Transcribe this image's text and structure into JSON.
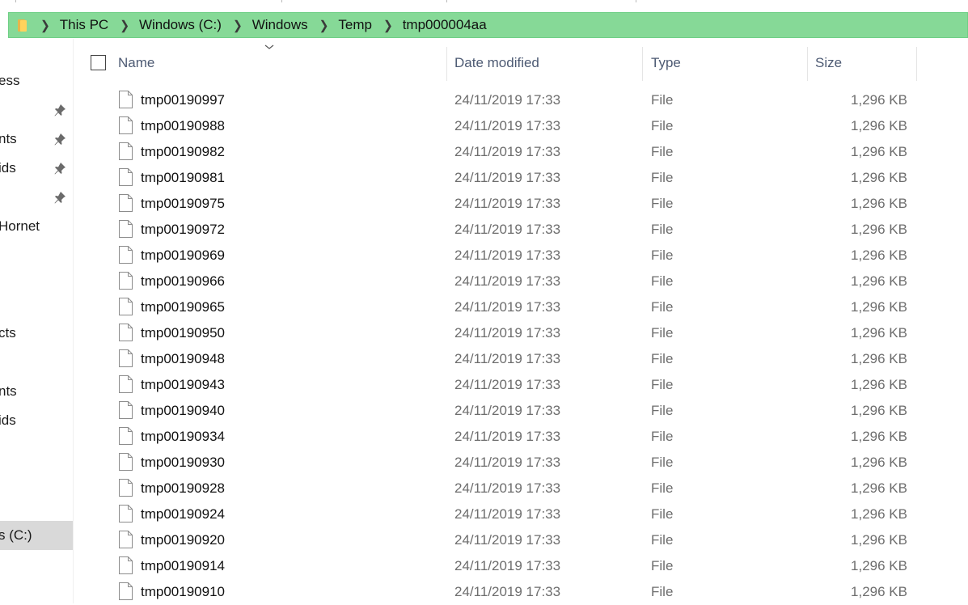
{
  "breadcrumb": [
    "This PC",
    "Windows (C:)",
    "Windows",
    "Temp",
    "tmp000004aa"
  ],
  "sidebar": {
    "items": [
      {
        "label": "ess",
        "pinned": false,
        "selected": false
      },
      {
        "label": "",
        "pinned": true,
        "selected": false
      },
      {
        "label": "nts",
        "pinned": true,
        "selected": false
      },
      {
        "label": "ids",
        "pinned": true,
        "selected": false
      },
      {
        "label": "",
        "pinned": true,
        "selected": false
      },
      {
        "label": "Hornet",
        "pinned": false,
        "selected": false
      },
      {
        "label": "cts",
        "pinned": false,
        "selected": false
      },
      {
        "label": "nts",
        "pinned": false,
        "selected": false
      },
      {
        "label": "ids",
        "pinned": false,
        "selected": false
      },
      {
        "label": "s (C:)",
        "pinned": false,
        "selected": true
      }
    ]
  },
  "columns": {
    "name": "Name",
    "date": "Date modified",
    "type": "Type",
    "size": "Size"
  },
  "files": [
    {
      "name": "tmp00190997",
      "date": "24/11/2019 17:33",
      "type": "File",
      "size": "1,296 KB"
    },
    {
      "name": "tmp00190988",
      "date": "24/11/2019 17:33",
      "type": "File",
      "size": "1,296 KB"
    },
    {
      "name": "tmp00190982",
      "date": "24/11/2019 17:33",
      "type": "File",
      "size": "1,296 KB"
    },
    {
      "name": "tmp00190981",
      "date": "24/11/2019 17:33",
      "type": "File",
      "size": "1,296 KB"
    },
    {
      "name": "tmp00190975",
      "date": "24/11/2019 17:33",
      "type": "File",
      "size": "1,296 KB"
    },
    {
      "name": "tmp00190972",
      "date": "24/11/2019 17:33",
      "type": "File",
      "size": "1,296 KB"
    },
    {
      "name": "tmp00190969",
      "date": "24/11/2019 17:33",
      "type": "File",
      "size": "1,296 KB"
    },
    {
      "name": "tmp00190966",
      "date": "24/11/2019 17:33",
      "type": "File",
      "size": "1,296 KB"
    },
    {
      "name": "tmp00190965",
      "date": "24/11/2019 17:33",
      "type": "File",
      "size": "1,296 KB"
    },
    {
      "name": "tmp00190950",
      "date": "24/11/2019 17:33",
      "type": "File",
      "size": "1,296 KB"
    },
    {
      "name": "tmp00190948",
      "date": "24/11/2019 17:33",
      "type": "File",
      "size": "1,296 KB"
    },
    {
      "name": "tmp00190943",
      "date": "24/11/2019 17:33",
      "type": "File",
      "size": "1,296 KB"
    },
    {
      "name": "tmp00190940",
      "date": "24/11/2019 17:33",
      "type": "File",
      "size": "1,296 KB"
    },
    {
      "name": "tmp00190934",
      "date": "24/11/2019 17:33",
      "type": "File",
      "size": "1,296 KB"
    },
    {
      "name": "tmp00190930",
      "date": "24/11/2019 17:33",
      "type": "File",
      "size": "1,296 KB"
    },
    {
      "name": "tmp00190928",
      "date": "24/11/2019 17:33",
      "type": "File",
      "size": "1,296 KB"
    },
    {
      "name": "tmp00190924",
      "date": "24/11/2019 17:33",
      "type": "File",
      "size": "1,296 KB"
    },
    {
      "name": "tmp00190920",
      "date": "24/11/2019 17:33",
      "type": "File",
      "size": "1,296 KB"
    },
    {
      "name": "tmp00190914",
      "date": "24/11/2019 17:33",
      "type": "File",
      "size": "1,296 KB"
    },
    {
      "name": "tmp00190910",
      "date": "24/11/2019 17:33",
      "type": "File",
      "size": "1,296 KB"
    }
  ],
  "colors": {
    "address_bar": "#86d997",
    "selected_nav": "#d9d9d9",
    "header_text": "#4d5a73",
    "secondary_text": "#6d6d6d"
  },
  "icons": {
    "address": "folder-icon",
    "separator": "chevron-right-icon",
    "pin": "pin-icon",
    "file": "file-icon",
    "sort": "chevron-down-icon"
  }
}
